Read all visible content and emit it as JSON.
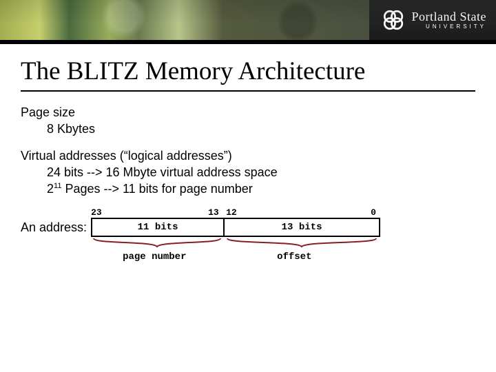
{
  "brand": {
    "name_line1": "Portland State",
    "name_line2": "UNIVERSITY"
  },
  "title": "The BLITZ Memory Architecture",
  "body": {
    "page_size_label": "Page size",
    "page_size_value": "8 Kbytes",
    "va_heading": "Virtual addresses (“logical addresses”)",
    "va_line1": "24 bits  -->  16 Mbyte virtual address space",
    "va_line2_prefix": "2",
    "va_line2_exp": "11",
    "va_line2_rest": " Pages  --> 11 bits for page number",
    "addr_label": "An address:"
  },
  "diagram": {
    "bit_labels": {
      "msb": "23",
      "mid_left": "13",
      "mid_right": "12",
      "lsb": "0"
    },
    "field_left": "11 bits",
    "field_right": "13 bits",
    "under_left": "page number",
    "under_right": "offset"
  },
  "colors": {
    "brace": "#8a1d22"
  }
}
